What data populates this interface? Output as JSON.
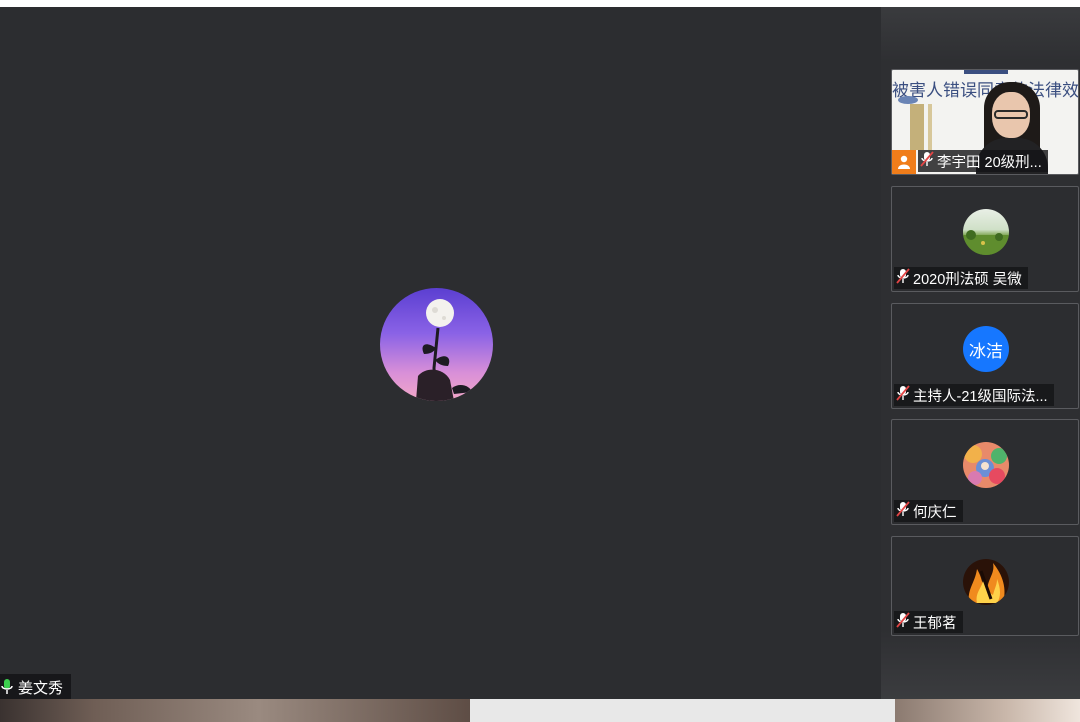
{
  "main": {
    "speaker_name": "姜文秀"
  },
  "participants": [
    {
      "name": "李宇田 20级刑...",
      "role_badge": "host-person-icon",
      "muted": true,
      "video": true,
      "slide_title": "被害人错误同意的法律效果"
    },
    {
      "name": "2020刑法硕 吴微",
      "muted": true,
      "avatar": "landscape-photo"
    },
    {
      "name": "主持人-21级国际法...",
      "muted": true,
      "avatar_text": "冰洁",
      "avatar_color": "#1677ff"
    },
    {
      "name": "何庆仁",
      "muted": true,
      "avatar": "colorful-photo"
    },
    {
      "name": "王郁茗",
      "muted": true,
      "avatar": "fire-photo"
    }
  ],
  "colors": {
    "stage_bg": "#2c2d30",
    "host_badge": "#f07d1a",
    "text_avatar": "#1677ff",
    "mic_on": "#3ccf4e",
    "mic_muted": "#e24545"
  }
}
